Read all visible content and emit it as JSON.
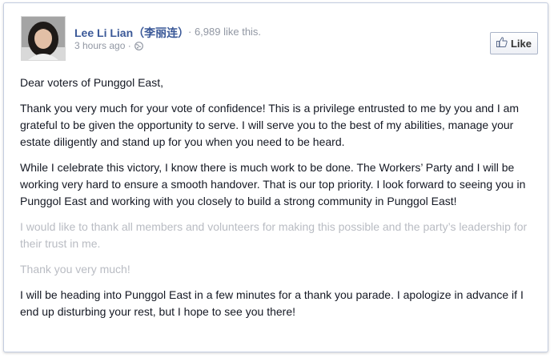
{
  "post": {
    "author_name": "Lee Li Lian（李丽连）",
    "like_summary": "· 6,989 like this.",
    "timestamp": "3 hours ago ·",
    "like_button_label": "Like",
    "paragraphs": [
      "Dear voters of Punggol East,",
      "Thank you very much for your vote of confidence! This is a privilege entrusted to me by you and I am grateful to be given the opportunity to serve. I will serve you to the best of my abilities, manage your estate diligently and stand up for you when you need to be heard.",
      "While I celebrate this victory, I know there is much work to be done. The Workers’ Party and I will be working very hard to ensure a smooth handover. That is our top priority. I look forward to seeing you in Punggol East and working with you closely to build a strong community in Punggol East!",
      "I would like to thank all members and volunteers for making this possible and the party’s leadership for their trust in me.",
      "Thank you very much!",
      "I will be heading into Punggol East in a few minutes for a thank you parade. I apologize in advance if I end up disturbing your rest, but I hope to see you there!"
    ]
  },
  "icons": {
    "privacy": "globe-icon",
    "like": "thumbs-up-icon"
  },
  "colors": {
    "link": "#3b5998",
    "meta": "#9197a3",
    "body_text": "#141823",
    "faded_text": "#b9bcc3"
  }
}
